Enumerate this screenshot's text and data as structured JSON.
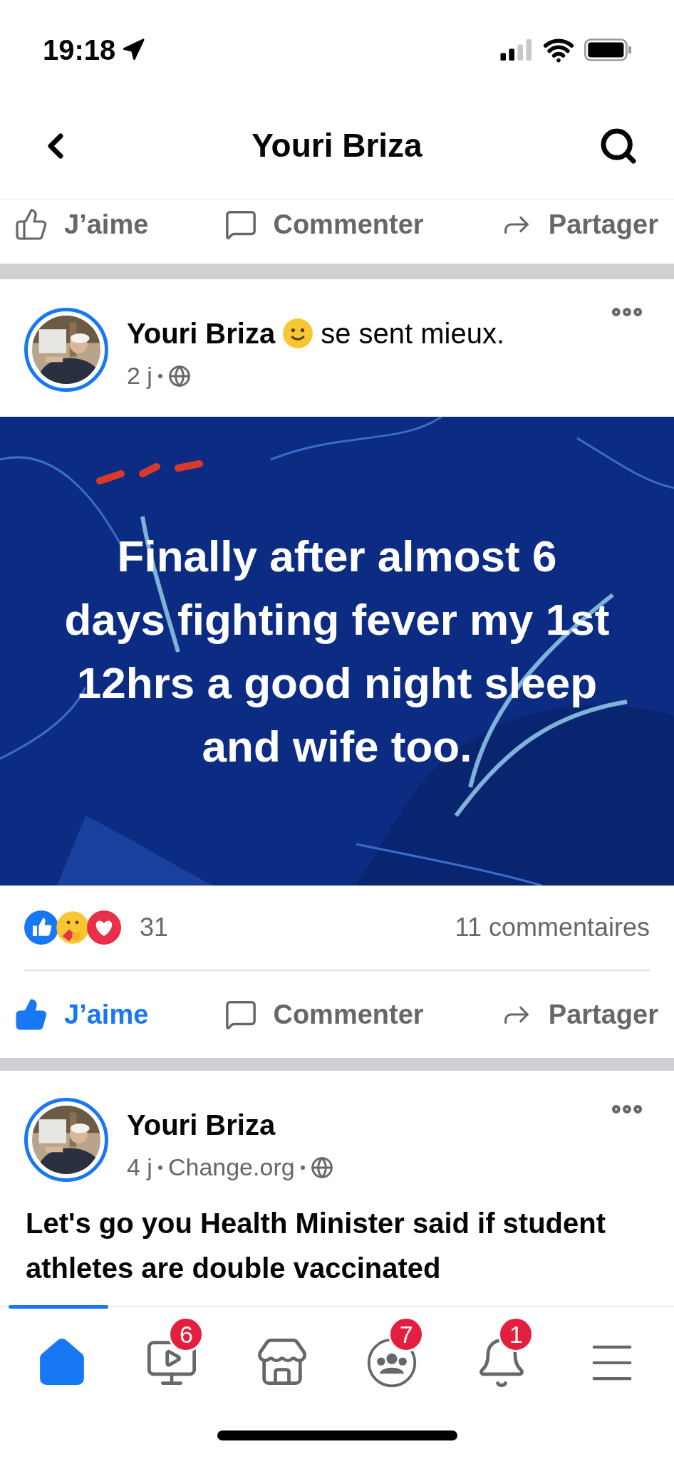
{
  "status_bar": {
    "time": "19:18"
  },
  "header": {
    "title": "Youri Briza"
  },
  "previous_post_actions": [
    {
      "kind": "like",
      "label": "J’aime",
      "selected": false
    },
    {
      "kind": "comment",
      "label": "Commenter"
    },
    {
      "kind": "share",
      "label": "Partager"
    }
  ],
  "posts": [
    {
      "author": "Youri Briza",
      "activity": "se sent mieux.",
      "meta": [
        "2 j"
      ],
      "background_text": "Finally after almost 6 days fighting fever my 1st 12hrs a good night sleep and wife too.",
      "reactions_count": "31",
      "comments_count": "11 commentaires",
      "actions": [
        {
          "kind": "like",
          "label": "J’aime",
          "selected": true
        },
        {
          "kind": "comment",
          "label": "Commenter"
        },
        {
          "kind": "share",
          "label": "Partager"
        }
      ]
    },
    {
      "author": "Youri Briza",
      "meta": [
        "4 j",
        "Change.org"
      ],
      "text": "Let's go you Health Minister said if student athletes are double vaccinated"
    }
  ],
  "tab_bar": [
    {
      "kind": "home",
      "selected": true
    },
    {
      "kind": "video",
      "badge": "6",
      "selected": false
    },
    {
      "kind": "marketplace",
      "selected": false
    },
    {
      "kind": "groups",
      "badge": "7",
      "selected": false
    },
    {
      "kind": "notifications",
      "badge": "1",
      "selected": false
    },
    {
      "kind": "menu",
      "selected": false
    }
  ]
}
